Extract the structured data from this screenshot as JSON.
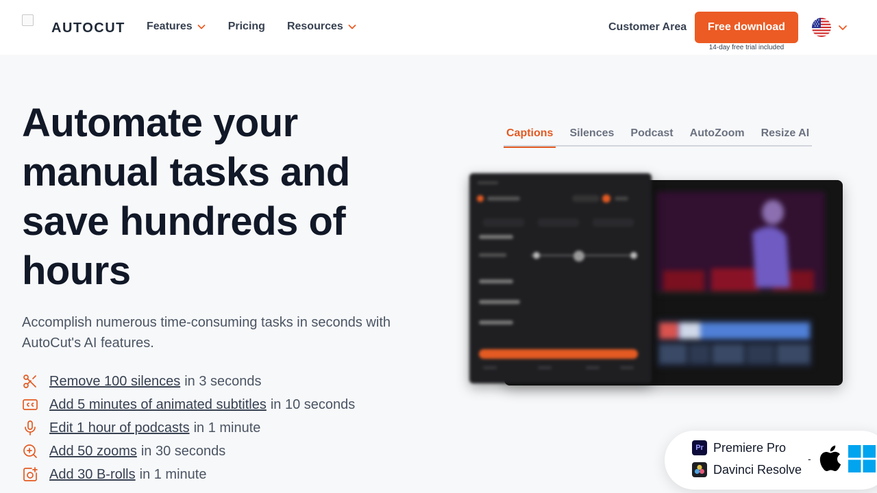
{
  "header": {
    "logo_text": "AUTOCUT",
    "nav": [
      {
        "label": "Features",
        "has_dropdown": true
      },
      {
        "label": "Pricing",
        "has_dropdown": false
      },
      {
        "label": "Resources",
        "has_dropdown": true
      }
    ],
    "customer_area": "Customer Area",
    "cta_label": "Free download",
    "cta_sub": "14-day free trial included",
    "language_icon": "us-flag-icon"
  },
  "hero": {
    "title": "Automate your manual tasks and save hundreds of hours",
    "subtitle": "Accomplish numerous time-consuming tasks in seconds with AutoCut's AI features.",
    "features": [
      {
        "icon": "scissors-icon",
        "link": "Remove 100 silences",
        "suffix": "in 3 seconds"
      },
      {
        "icon": "closed-captions-icon",
        "link": "Add 5 minutes of animated subtitles",
        "suffix": "in 10 seconds"
      },
      {
        "icon": "microphone-icon",
        "link": "Edit 1 hour of podcasts",
        "suffix": "in 1 minute"
      },
      {
        "icon": "zoom-in-icon",
        "link": "Add 50 zooms",
        "suffix": "in 30 seconds"
      },
      {
        "icon": "image-plus-icon",
        "link": "Add 30 B-rolls",
        "suffix": "in 1 minute"
      }
    ]
  },
  "preview": {
    "tabs": [
      "Captions",
      "Silences",
      "Podcast",
      "AutoZoom",
      "Resize AI"
    ],
    "active_tab": "Captions"
  },
  "integrations": {
    "apps": [
      "Premiere Pro",
      "Davinci Resolve"
    ],
    "separator": "-",
    "platforms": [
      "apple-icon",
      "windows-icon"
    ]
  },
  "colors": {
    "accent": "#ec5b24",
    "text_dark": "#111827",
    "text_muted": "#4b5563",
    "background": "#f7f8fa"
  }
}
